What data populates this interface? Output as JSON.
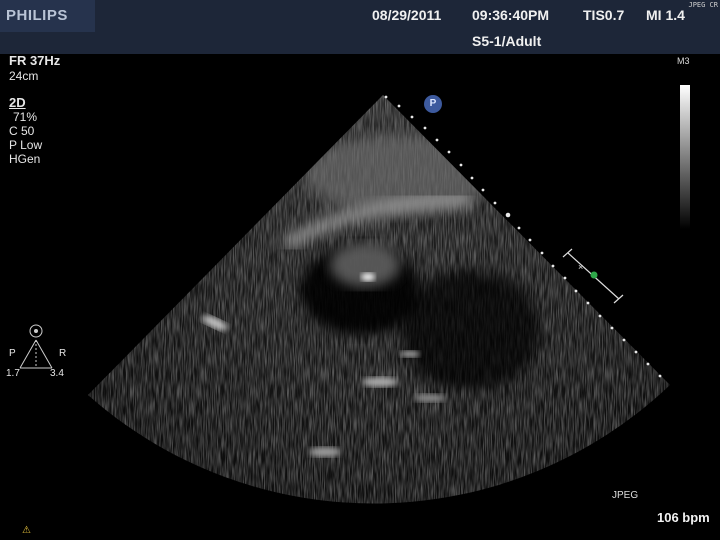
{
  "header": {
    "brand": "PHILIPS",
    "date": "08/29/2011",
    "time": "09:36:40PM",
    "tis": "TIS0.7",
    "mi": "MI 1.4",
    "probe_preset": "S5-1/Adult",
    "corner_tag": "JPEG CR"
  },
  "left_panel": {
    "frame_rate": "FR 37Hz",
    "depth": "24cm",
    "mode": "2D",
    "gain": "71%",
    "compression": "C 50",
    "power": "P Low",
    "harmonic": "HGen"
  },
  "orientation": {
    "left_label": "P",
    "right_label": "R",
    "left_value": "1.7",
    "right_value": "3.4"
  },
  "grayscale": {
    "label": "M3"
  },
  "probe_marker": {
    "label": "P",
    "color": "#3d5a9e"
  },
  "footer": {
    "format": "JPEG",
    "heart_rate": "106 bpm"
  },
  "colors": {
    "header_bg": "#1d2638",
    "focus_marker": "#2fa84a",
    "warning": "#e6c23c"
  }
}
